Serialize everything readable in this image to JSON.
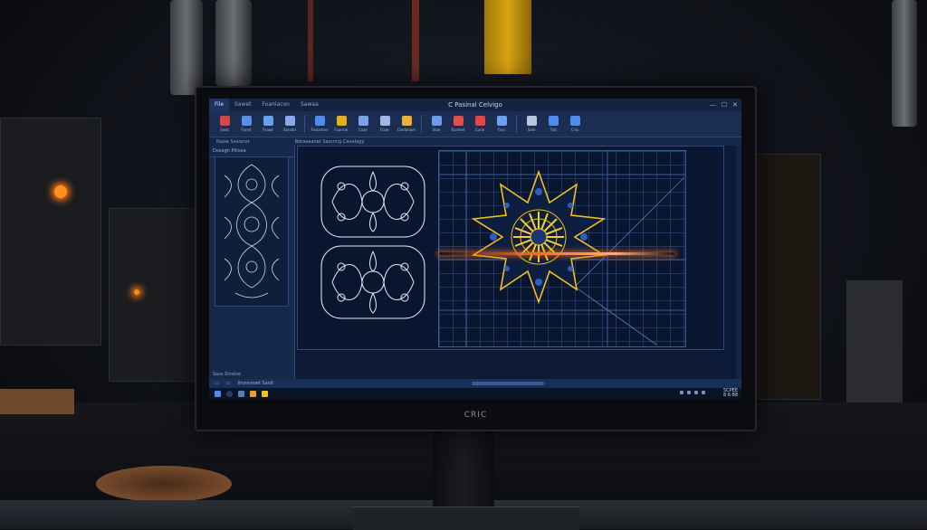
{
  "window": {
    "title": "C Pasinal Celvigo",
    "tabs": [
      "File",
      "Sawet",
      "Foaniacon",
      "Sawaa"
    ],
    "controls": [
      "—",
      "☐",
      "✕"
    ]
  },
  "ribbon": {
    "buttons": [
      {
        "label": "Sewt",
        "icon": "cursor-icon",
        "color": "#d04a4a"
      },
      {
        "label": "Fonet",
        "icon": "layers-icon",
        "color": "#5d8ee6"
      },
      {
        "label": "Feawt",
        "icon": "pen-icon",
        "color": "#6aa0f0"
      },
      {
        "label": "Sanata",
        "icon": "node-icon",
        "color": "#88a8e8"
      },
      {
        "label": "Fiosaman",
        "icon": "curve-icon",
        "color": "#4f8be8"
      },
      {
        "label": "Fuanrat",
        "icon": "brush-icon",
        "color": "#e0b020"
      },
      {
        "label": "Coan",
        "icon": "shape-icon",
        "color": "#7aa3e8"
      },
      {
        "label": "Flaer",
        "icon": "page-icon",
        "color": "#9fb8e8"
      },
      {
        "label": "Canfanam",
        "icon": "gear-icon",
        "color": "#e8b23a"
      },
      {
        "label": "Stae",
        "icon": "line-icon",
        "color": "#6d9ae8"
      },
      {
        "label": "Rasmet",
        "icon": "bookmark-icon",
        "color": "#e05050"
      },
      {
        "label": "Curie",
        "icon": "tool-icon",
        "color": "#e04848"
      },
      {
        "label": "Fans",
        "icon": "target-icon",
        "color": "#6ea0f0"
      },
      {
        "label": "Sale",
        "icon": "print-icon",
        "color": "#b8c6e0"
      },
      {
        "label": "Tlot",
        "icon": "globe-icon",
        "color": "#4f8be8"
      },
      {
        "label": "Crio",
        "icon": "knife-icon",
        "color": "#4f8be8"
      }
    ]
  },
  "subbar": {
    "left": "Naow Sesianst",
    "mid": "Bdraeaanet Sassnng Cavafagy"
  },
  "leftpanel": {
    "header": "Dosagn Pilivea",
    "footer": "Sass Sinalse"
  },
  "status": {
    "items": [
      "▭",
      "▭",
      "Ilnzovsoet Sanlt"
    ]
  },
  "taskbar": {
    "clock_line1": "5CPEE",
    "clock_line2": "8 6:88"
  },
  "monitor": {
    "brand": "CRIC"
  },
  "colors": {
    "accent": "#f0c020",
    "line": "#e8ecf4",
    "laser": "#ff6a1a"
  }
}
